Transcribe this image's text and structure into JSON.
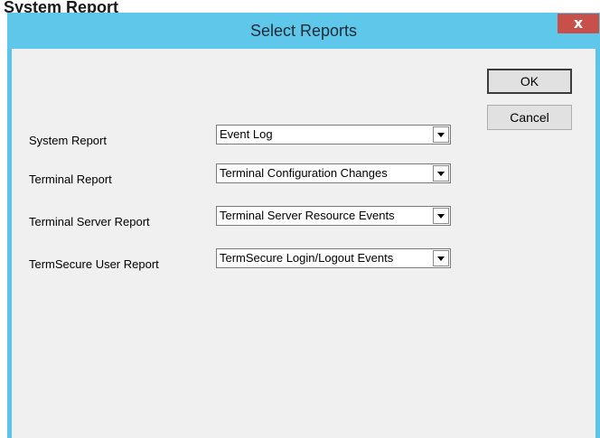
{
  "background": {
    "caption": "System Report"
  },
  "window": {
    "title": "Select Reports",
    "close_glyph": "x",
    "close_icon": "close-icon"
  },
  "buttons": {
    "ok": "OK",
    "cancel": "Cancel"
  },
  "reports": [
    {
      "label": "System Report",
      "value": "Event Log"
    },
    {
      "label": "Terminal Report",
      "value": "Terminal Configuration Changes"
    },
    {
      "label": "Terminal Server Report",
      "value": "Terminal Server Resource Events"
    },
    {
      "label": "TermSecure User Report",
      "value": "TermSecure Login/Logout Events"
    }
  ],
  "colors": {
    "titlebar": "#5ec7ea",
    "close_button": "#c7504a",
    "client": "#f0f0f0"
  }
}
